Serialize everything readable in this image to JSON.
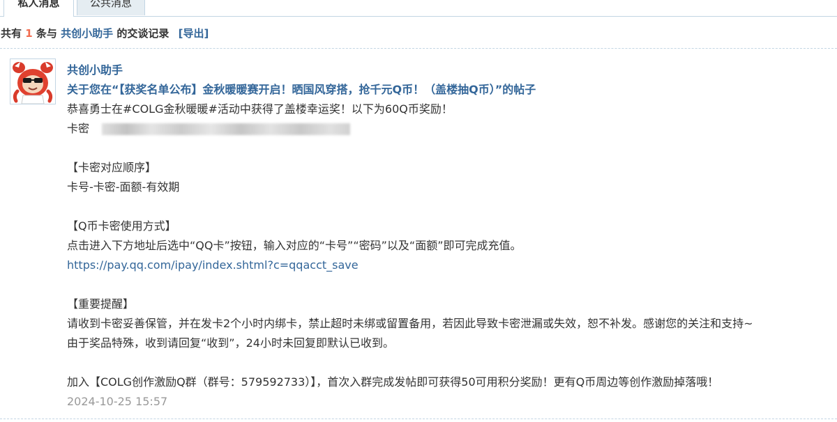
{
  "tabs": {
    "private": "私人消息",
    "public": "公共消息"
  },
  "summary": {
    "prefix": "共有",
    "count": "1",
    "mid": "条与",
    "contact": "共创小助手",
    "suffix": "的交谈记录",
    "export": "[导出]"
  },
  "message": {
    "sender": "共创小助手",
    "thread_title": "关于您在“【获奖名单公布】金秋暖暖赛开启！晒国风穿搭，抢千元Q币！（盖楼抽Q币）”的帖子",
    "lines": {
      "l1": "恭喜勇士在#COLG金秋暖暖#活动中获得了盖楼幸运奖！以下为60Q币奖励！",
      "l2": "卡密",
      "l3": "【卡密对应顺序】",
      "l4": "卡号-卡密-面额-有效期",
      "l5": "【Q币卡密使用方式】",
      "l6": "点击进入下方地址后选中“QQ卡”按钮，输入对应的“卡号”“密码”以及“面额”即可完成充值。",
      "link": "https://pay.qq.com/ipay/index.shtml?c=qqacct_save",
      "l7": "【重要提醒】",
      "l8": "请收到卡密妥善保管，并在发卡2个小时内绑卡，禁止超时未绑或留置备用，若因此导致卡密泄漏或失效，恕不补发。感谢您的关注和支持~",
      "l9": "由于奖品特殊，收到请回复“收到”，24小时未回复即默认已收到。",
      "l10": "加入【COLG创作激励Q群（群号：579592733）】，首次入群完成发帖即可获得50可用积分奖励！更有Q币周边等创作激励掉落哦！"
    },
    "timestamp": "2024-10-25 15:57"
  },
  "colors": {
    "link_blue": "#336699",
    "count_red": "#f26c4f",
    "border": "#c2d5e3",
    "timestamp_gray": "#999999"
  },
  "icons": {
    "avatar": "red-crab-mascot-with-sunglasses-avatar"
  }
}
